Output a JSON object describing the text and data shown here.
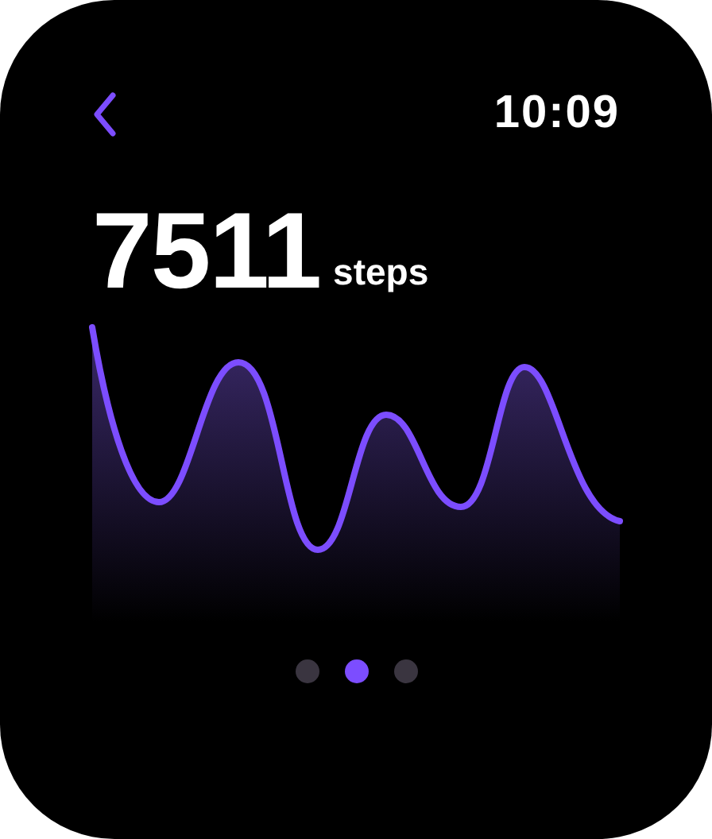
{
  "status": {
    "time": "10:09"
  },
  "steps": {
    "value": "7511",
    "unit": "steps"
  },
  "pager": [
    {
      "selected": false
    },
    {
      "selected": true
    },
    {
      "selected": false
    }
  ]
}
